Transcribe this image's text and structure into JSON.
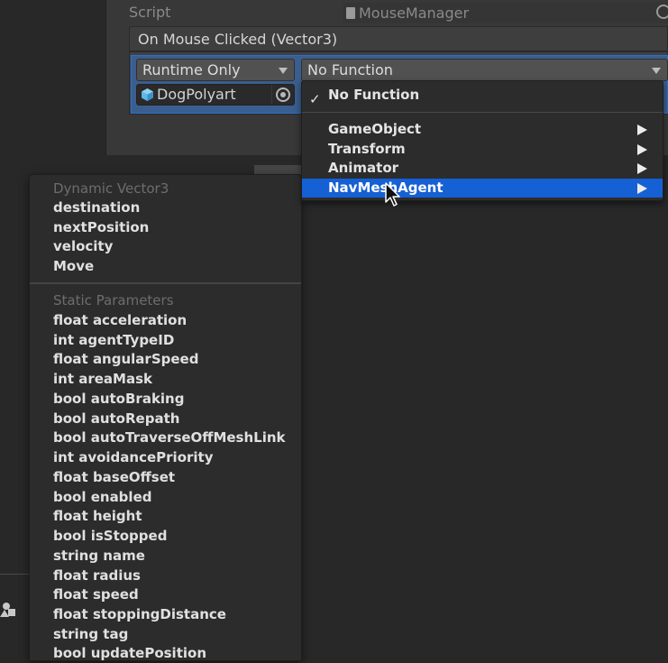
{
  "inspector": {
    "script_label": "Script",
    "script_value": "MouseManager",
    "event_header": "On Mouse Clicked (Vector3)",
    "runtime_dropdown": "Runtime Only",
    "function_dropdown": "No Function",
    "object_field": "DogPolyart"
  },
  "function_menu": {
    "selected": "No Function",
    "items": [
      "GameObject",
      "Transform",
      "Animator",
      "NavMeshAgent"
    ],
    "highlighted": "NavMeshAgent"
  },
  "properties_menu": {
    "dynamic_header": "Dynamic Vector3",
    "dynamic_items": [
      "destination",
      "nextPosition",
      "velocity",
      "Move"
    ],
    "static_header": "Static Parameters",
    "static_items": [
      "float acceleration",
      "int agentTypeID",
      "float angularSpeed",
      "int areaMask",
      "bool autoBraking",
      "bool autoRepath",
      "bool autoTraverseOffMeshLink",
      "int avoidancePriority",
      "float baseOffset",
      "bool enabled",
      "float height",
      "bool isStopped",
      "string name",
      "float radius",
      "float speed",
      "float stoppingDistance",
      "string tag",
      "bool updatePosition"
    ]
  },
  "icons": {
    "script": "script-file-icon",
    "target": "object-picker-icon",
    "cube": "gameobject-cube-icon",
    "check": "checkmark-icon",
    "submenu": "submenu-arrow-icon",
    "cursor": "mouse-pointer-icon"
  },
  "colors": {
    "highlight": "#1560d4",
    "row_selected": "#3a5e8f",
    "cube": "#5fb8e8"
  }
}
